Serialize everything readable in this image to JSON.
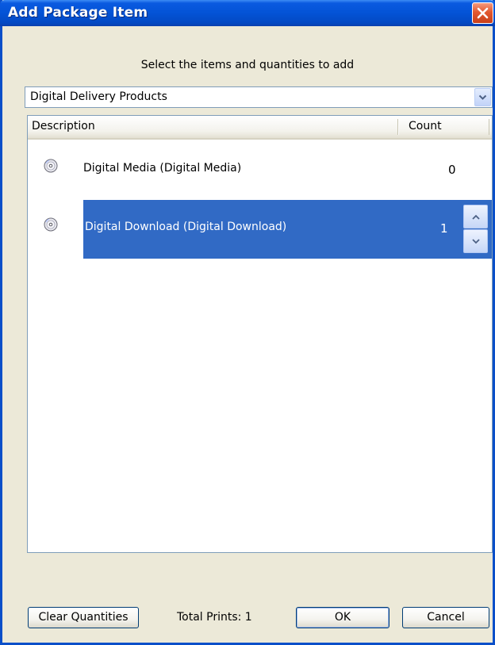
{
  "window": {
    "title": "Add Package Item"
  },
  "instruction": "Select the items and quantities to add",
  "category": {
    "selected": "Digital Delivery Products"
  },
  "list": {
    "columns": {
      "description": "Description",
      "count": "Count"
    },
    "items": [
      {
        "label": "Digital Media (Digital Media)",
        "count": "0",
        "icon": "disc-icon",
        "selected": false
      },
      {
        "label": "Digital Download (Digital Download)",
        "count": "1",
        "icon": "disc-icon",
        "selected": true
      }
    ]
  },
  "footer": {
    "clear_label": "Clear Quantities",
    "total_label": "Total Prints: 1",
    "ok_label": "OK",
    "cancel_label": "Cancel"
  },
  "colors": {
    "selection": "#316ac5",
    "titlebar": "#0353d6",
    "dialog_bg": "#ece9d8"
  }
}
